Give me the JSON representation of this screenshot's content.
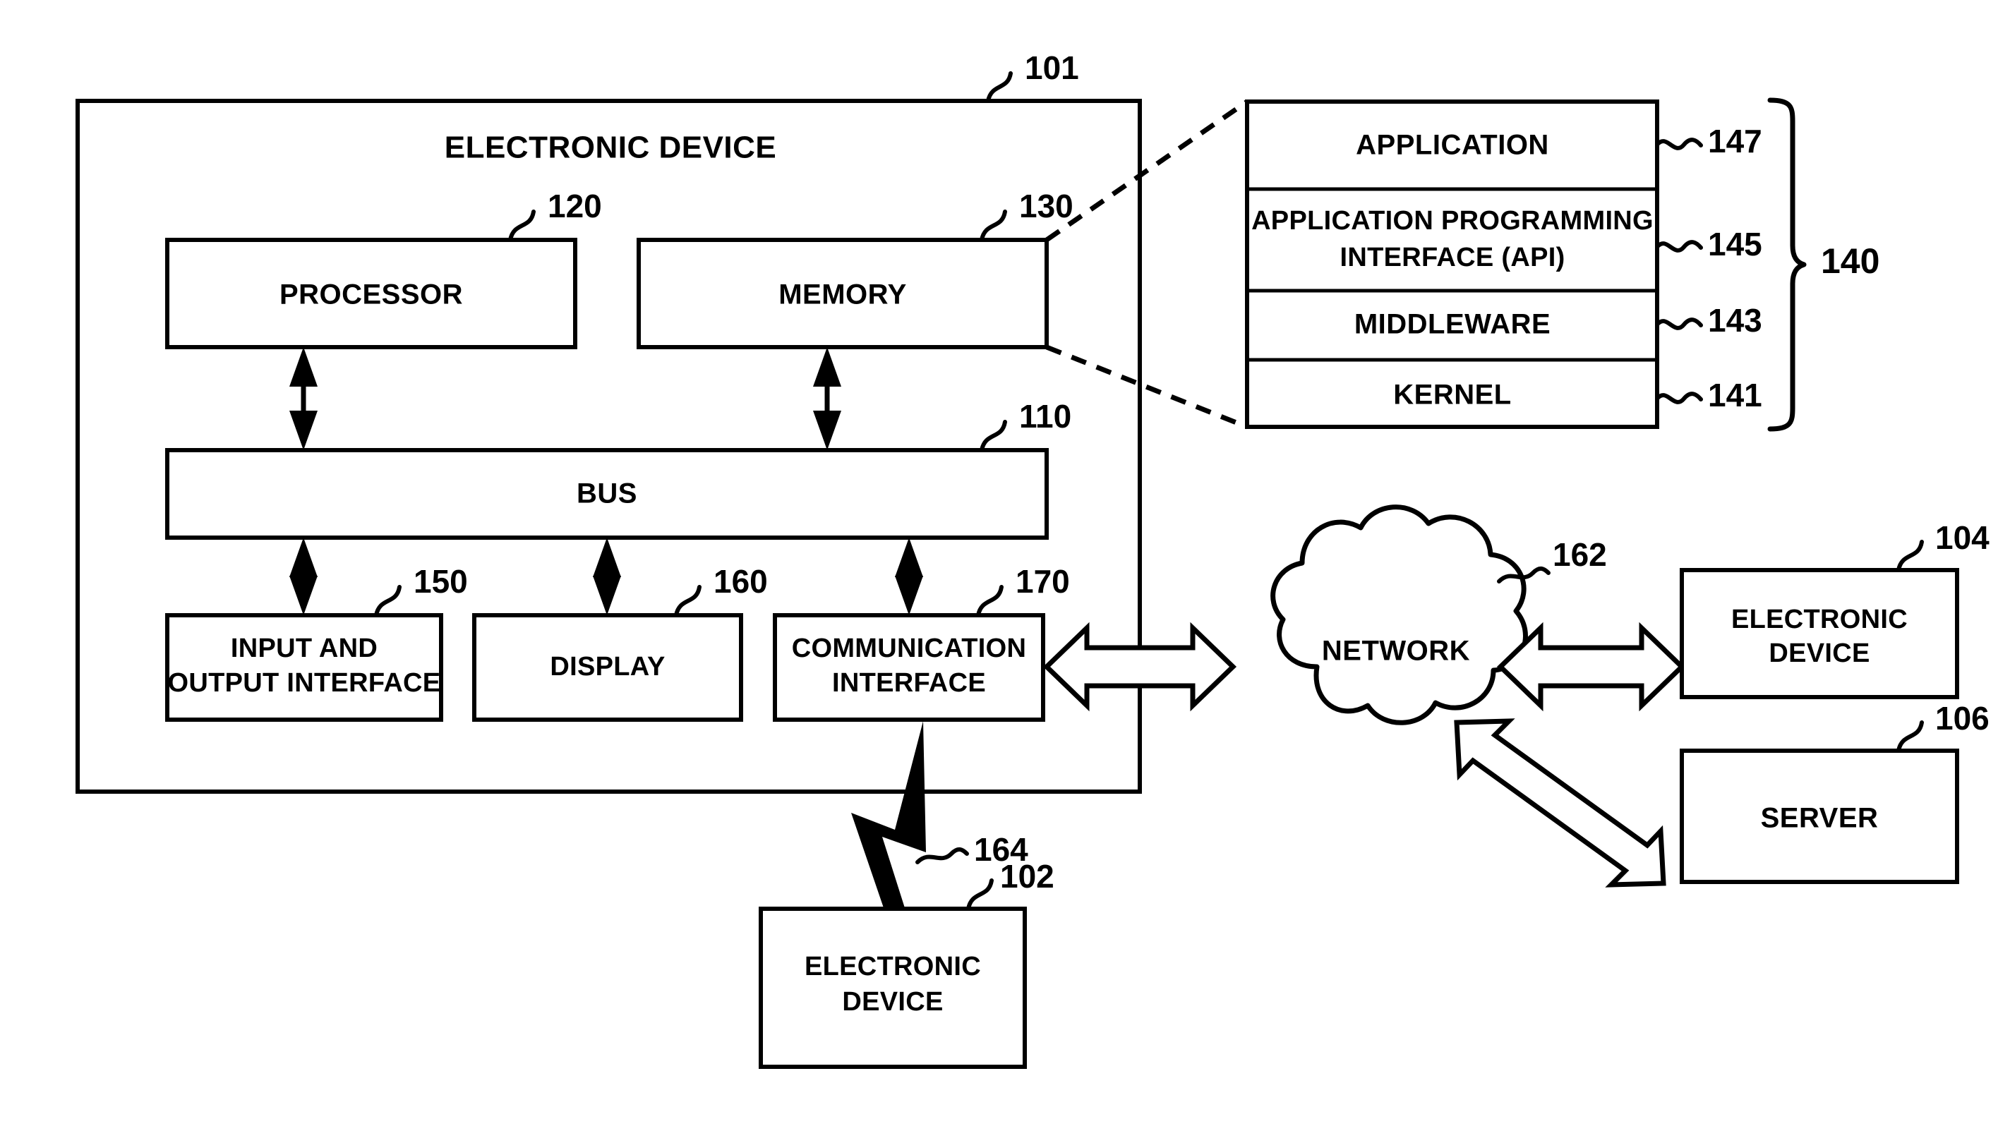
{
  "figure": {
    "type": "patent-block-diagram",
    "title_label": "ELECTRONIC DEVICE",
    "main_ref": "101"
  },
  "main_device": {
    "label": "ELECTRONIC DEVICE",
    "ref": "101",
    "components": [
      {
        "key": "processor",
        "label": "PROCESSOR",
        "ref": "120"
      },
      {
        "key": "memory",
        "label": "MEMORY",
        "ref": "130"
      },
      {
        "key": "bus",
        "label": "BUS",
        "ref": "110"
      },
      {
        "key": "io",
        "label_line1": "INPUT AND",
        "label_line2": "OUTPUT INTERFACE",
        "ref": "150"
      },
      {
        "key": "display",
        "label": "DISPLAY",
        "ref": "160"
      },
      {
        "key": "comm",
        "label_line1": "COMMUNICATION",
        "label_line2": "INTERFACE",
        "ref": "170"
      }
    ]
  },
  "software_stack": {
    "group_ref": "140",
    "layers": [
      {
        "label": "APPLICATION",
        "ref": "147"
      },
      {
        "label_line1": "APPLICATION PROGRAMMING",
        "label_line2": "INTERFACE (API)",
        "ref": "145"
      },
      {
        "label": "MIDDLEWARE",
        "ref": "143"
      },
      {
        "label": "KERNEL",
        "ref": "141"
      }
    ]
  },
  "network": {
    "label": "NETWORK",
    "ref": "162"
  },
  "wireless_link": {
    "ref": "164"
  },
  "external_nodes": [
    {
      "key": "device-102",
      "label_line1": "ELECTRONIC",
      "label_line2": "DEVICE",
      "ref": "102"
    },
    {
      "key": "device-104",
      "label_line1": "ELECTRONIC",
      "label_line2": "DEVICE",
      "ref": "104"
    },
    {
      "key": "server-106",
      "label": "SERVER",
      "ref": "106"
    }
  ],
  "colors": {
    "stroke": "#000000",
    "fill": "#ffffff"
  }
}
